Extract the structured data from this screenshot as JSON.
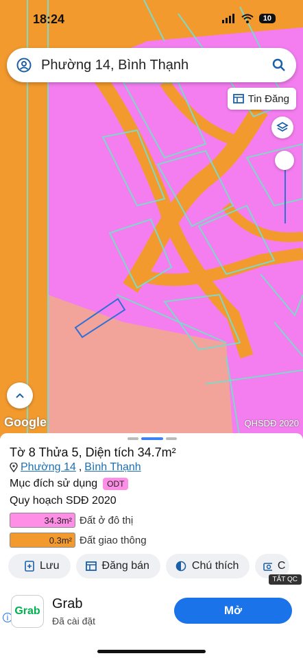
{
  "status": {
    "time": "18:24",
    "battery": "10"
  },
  "search": {
    "text": "Phường 14, Bình Thạnh"
  },
  "map": {
    "tin_dang_label": "Tin Đăng",
    "watermark": "QHSDĐ 2020",
    "google_label": "Google",
    "colors": {
      "residential": "#f47ef0",
      "traffic": "#f29a2e",
      "other": "#f2a49a",
      "border": "#7fd8c8"
    }
  },
  "sheet": {
    "title": "Tờ 8 Thửa 5, Diện tích 34.7m²",
    "ward": "Phường 14",
    "district": "Bình Thạnh",
    "addr_sep": ",",
    "purpose_label": "Mục đích sử dụng",
    "purpose_badge": "ODT",
    "plan_label": "Quy hoạch SDĐ 2020",
    "legend": [
      {
        "value": "34.3m²",
        "label": "Đất ở đô thị",
        "color": "#ff8fe6"
      },
      {
        "value": "0.3m²",
        "label": "Đất giao thông",
        "color": "#f29a2e"
      }
    ],
    "actions": [
      {
        "label": "Lưu",
        "icon": "add-doc-icon"
      },
      {
        "label": "Đăng bán",
        "icon": "listing-icon"
      },
      {
        "label": "Chú thích",
        "icon": "legend-icon"
      },
      {
        "label": "C",
        "icon": "camera-icon"
      }
    ],
    "close_ad": "TẮT QC"
  },
  "ad": {
    "logo": "Grab",
    "name": "Grab",
    "subtitle": "Đã cài đặt",
    "button": "Mở"
  }
}
